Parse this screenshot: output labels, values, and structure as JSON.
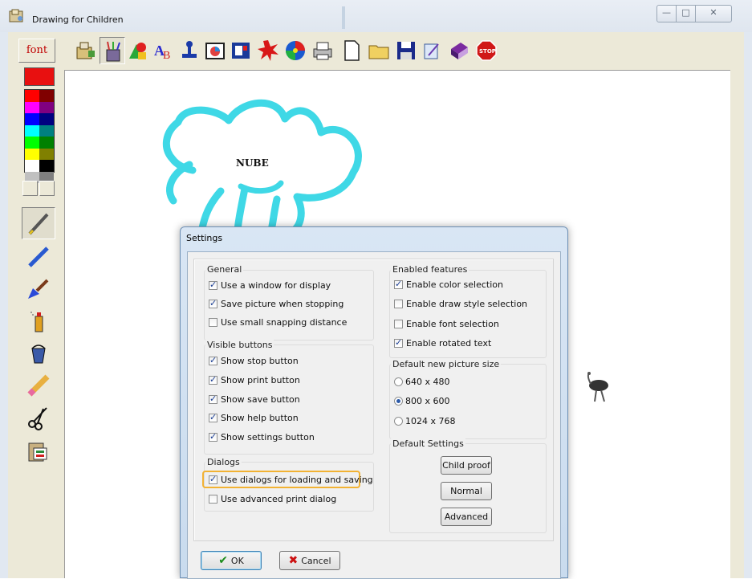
{
  "window": {
    "title": "Drawing for Children",
    "buttons": {
      "minimize": "—",
      "maximize": "□",
      "close": "✕"
    }
  },
  "toolbar": {
    "font_label": "font",
    "buttons": [
      "settings-icon",
      "brushes-icon",
      "shapes-icon",
      "text-icon",
      "stamp-icon",
      "picture-icon",
      "frame-icon",
      "burst-icon",
      "spiral-icon",
      "print-icon",
      "new-file-icon",
      "open-folder-icon",
      "save-disk-icon",
      "edit-icon",
      "help-book-icon",
      "stop-icon"
    ]
  },
  "palette": {
    "current_color": "#e81010",
    "colors": [
      "#ff0000",
      "#800000",
      "#ff00ff",
      "#800080",
      "#0000ff",
      "#000080",
      "#00ffff",
      "#008080",
      "#00ff00",
      "#008000",
      "#ffff00",
      "#808000",
      "#ffffff",
      "#000000",
      "#c0c0c0",
      "#808080"
    ]
  },
  "left_tools": [
    "pen-icon",
    "marker-icon",
    "brush-icon",
    "spray-can-icon",
    "bucket-icon",
    "eraser-icon",
    "scissors-icon",
    "paste-icon"
  ],
  "canvas": {
    "label": "NUBE",
    "stroke_color": "#3fd8e6"
  },
  "dialog": {
    "title": "Settings",
    "general": {
      "label": "General",
      "options": [
        {
          "label": "Use a window for display",
          "checked": true
        },
        {
          "label": "Save picture when stopping",
          "checked": true
        },
        {
          "label": "Use small snapping distance",
          "checked": false
        }
      ]
    },
    "visible_buttons": {
      "label": "Visible buttons",
      "options": [
        {
          "label": "Show stop button",
          "checked": true
        },
        {
          "label": "Show print button",
          "checked": true
        },
        {
          "label": "Show save button",
          "checked": true
        },
        {
          "label": "Show help button",
          "checked": true
        },
        {
          "label": "Show settings button",
          "checked": true
        }
      ]
    },
    "dialogs": {
      "label": "Dialogs",
      "options": [
        {
          "label": "Use dialogs for loading and saving",
          "checked": true
        },
        {
          "label": "Use advanced print dialog",
          "checked": false
        }
      ]
    },
    "enabled_features": {
      "label": "Enabled features",
      "options": [
        {
          "label": "Enable color selection",
          "checked": true
        },
        {
          "label": "Enable draw style selection",
          "checked": false
        },
        {
          "label": "Enable font selection",
          "checked": false
        },
        {
          "label": "Enable rotated text",
          "checked": true
        }
      ]
    },
    "picture_size": {
      "label": "Default new picture size",
      "options": [
        {
          "label": "640 x 480",
          "selected": false
        },
        {
          "label": "800 x 600",
          "selected": true
        },
        {
          "label": "1024 x 768",
          "selected": false
        }
      ]
    },
    "default_settings": {
      "label": "Default Settings",
      "buttons": [
        "Child proof",
        "Normal",
        "Advanced"
      ]
    },
    "ok_label": "OK",
    "cancel_label": "Cancel"
  }
}
